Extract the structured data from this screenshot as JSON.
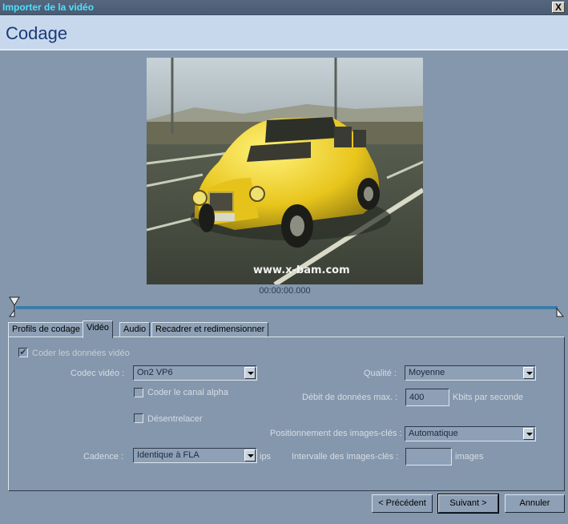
{
  "window": {
    "title": "Importer de la vidéo",
    "close_glyph": "X"
  },
  "header": {
    "title": "Codage"
  },
  "preview": {
    "watermark": "www.x-bam.com",
    "timecode": "00:00:00.000"
  },
  "tabs": [
    {
      "label": "Profils de codage",
      "active": false
    },
    {
      "label": "Vidéo",
      "active": true
    },
    {
      "label": "Audio",
      "active": false
    },
    {
      "label": "Recadrer et redimensionner",
      "active": false
    }
  ],
  "video": {
    "encode_checkbox_label": "Coder les données vidéo",
    "encode_checked": true,
    "codec_label": "Codec vidéo :",
    "codec_value": "On2 VP6",
    "alpha_label": "Coder le canal alpha",
    "deinterlace_label": "Désentrelacer",
    "framerate_label": "Cadence :",
    "framerate_value": "Identique à FLA",
    "framerate_unit": "ips",
    "quality_label": "Qualité :",
    "quality_value": "Moyenne",
    "bitrate_label": "Débit de données max. :",
    "bitrate_value": "400",
    "bitrate_unit": "Kbits par seconde",
    "keyframe_pos_label": "Positionnement des images-clés :",
    "keyframe_pos_value": "Automatique",
    "keyframe_interval_label": "Intervalle des images-clés :",
    "keyframe_interval_value": "",
    "keyframe_interval_unit": "images"
  },
  "buttons": {
    "prev": "< Précédent",
    "next": "Suivant >",
    "cancel": "Annuler"
  }
}
